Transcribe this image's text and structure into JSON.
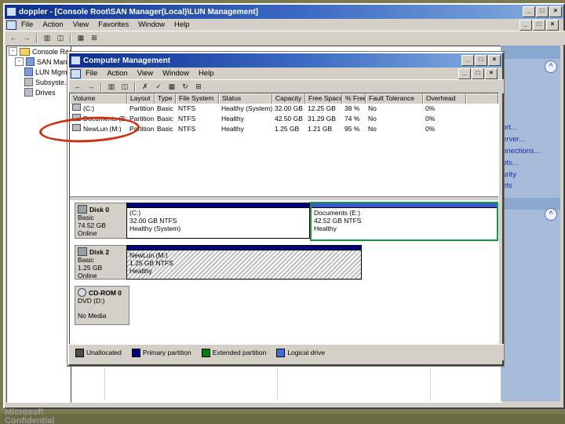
{
  "console": {
    "title": "doppler - [Console Root\\SAN Manager(Local)\\LUN Management]",
    "menu": [
      "File",
      "Action",
      "View",
      "Favorites",
      "Window",
      "Help"
    ],
    "toolbar_icons": [
      "←",
      "→",
      "▥",
      "◫",
      "▦",
      "⊞"
    ],
    "tree": [
      {
        "label": "Console Root"
      },
      {
        "label": "SAN Manager"
      },
      {
        "label": "LUN Mgmt"
      },
      {
        "label": "Subsyste..."
      },
      {
        "label": "Drives"
      }
    ],
    "task_links": [
      "ort...",
      "erver...",
      "nnections...",
      "pts...",
      "urity",
      "ets"
    ]
  },
  "cm": {
    "title": "Computer Management",
    "menu": [
      "File",
      "Action",
      "View",
      "Window",
      "Help"
    ],
    "toolbar_icons": [
      "←",
      "→",
      "▥",
      "◫",
      "✗",
      "✓",
      "▦",
      "↻",
      "⊞"
    ],
    "table": {
      "columns": [
        "Volume",
        "Layout",
        "Type",
        "File System",
        "Status",
        "Capacity",
        "Free Space",
        "% Free",
        "Fault Tolerance",
        "Overhead"
      ],
      "rows": [
        [
          "(C:)",
          "Partition",
          "Basic",
          "NTFS",
          "Healthy (System)",
          "32.00 GB",
          "12.25 GB",
          "38 %",
          "No",
          "0%"
        ],
        [
          "Documents (E:)",
          "Partition",
          "Basic",
          "NTFS",
          "Healthy",
          "42.50 GB",
          "31.29 GB",
          "74 %",
          "No",
          "0%"
        ],
        [
          "NewLun (M:)",
          "Partition",
          "Basic",
          "NTFS",
          "Healthy",
          "1.25 GB",
          "1.21 GB",
          "95 %",
          "No",
          "0%"
        ]
      ]
    },
    "disks": [
      {
        "name": "Disk 0",
        "kind": "Basic",
        "size": "74.52 GB",
        "status": "Online"
      },
      {
        "name": "Disk 2",
        "kind": "Basic",
        "size": "1.25 GB",
        "status": "Online"
      },
      {
        "name": "CD-ROM 0",
        "kind": "DVD (D:)",
        "status": "No Media"
      }
    ],
    "partitions": [
      {
        "title": "(C:)",
        "size": "32.00 GB NTFS",
        "status": "Healthy (System)"
      },
      {
        "title": "Documents (E:)",
        "size": "42.52 GB NTFS",
        "status": "Healthy"
      },
      {
        "title": "NewLun  (M:)",
        "size": "1.25 GB NTFS",
        "status": "Healthy"
      }
    ],
    "legend": [
      {
        "label": "Unallocated",
        "color": "#4d4d4d"
      },
      {
        "label": "Primary partition",
        "color": "#000080"
      },
      {
        "label": "Extended partition",
        "color": "#008000"
      },
      {
        "label": "Logical drive",
        "color": "#4169e1"
      }
    ]
  },
  "glyphs": {
    "minimize": "_",
    "maximize": "□",
    "close": "×",
    "chevron_up": "^",
    "minus": "-",
    "plus": "+"
  },
  "annotation": {
    "shape": "ellipse",
    "color": "#cf3010",
    "target": "NewLun (M:) volume row"
  },
  "footer": {
    "line1": "Microsoft",
    "line2": "Confidential"
  },
  "colors": {
    "desktop": "#7a7a4e",
    "titlebar_start": "#0d2f8e",
    "titlebar_end": "#86aede",
    "chrome": "#d4d0c8",
    "taskpane": "#a6bcda",
    "link": "#16309c"
  }
}
